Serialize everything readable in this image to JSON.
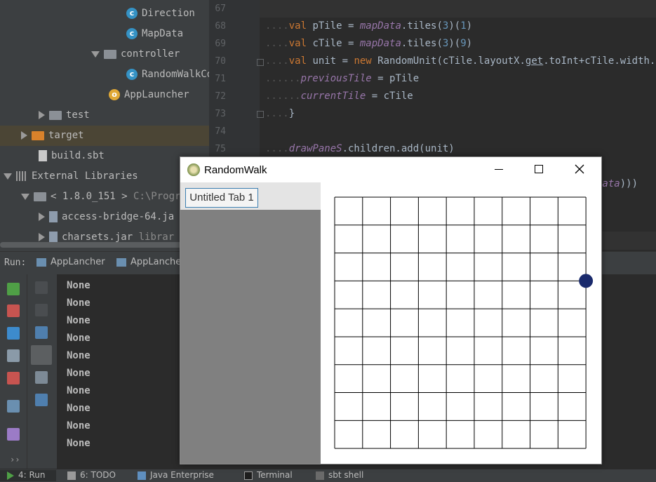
{
  "project_tree": {
    "items": [
      {
        "label": "Direction"
      },
      {
        "label": "MapData"
      },
      {
        "label": "controller"
      },
      {
        "label": "RandomWalkCo"
      },
      {
        "label": "AppLauncher"
      },
      {
        "label": "test"
      },
      {
        "label": "target"
      },
      {
        "label": "build.sbt"
      },
      {
        "label": "External Libraries"
      },
      {
        "label": "< 1.8.0_151 >",
        "extra": "C:\\Progr"
      },
      {
        "label": "access-bridge-64.ja"
      },
      {
        "label": "charsets.jar",
        "extra": "librar"
      }
    ]
  },
  "editor": {
    "line_numbers": [
      "67",
      "68",
      "69",
      "70",
      "71",
      "72",
      "73",
      "74",
      "75"
    ],
    "overflow_text": "Data)))"
  },
  "run": {
    "label": "Run:",
    "tabs": [
      "AppLancher",
      "AppLancher"
    ],
    "output": [
      "None",
      "None",
      "None",
      "None",
      "None",
      "None",
      "None",
      "None",
      "None",
      "None"
    ]
  },
  "bottom_tabs": [
    "4: Run",
    "6: TODO",
    "Java Enterprise",
    "Terminal",
    "sbt shell"
  ],
  "app_window": {
    "title": "RandomWalk",
    "tab_label": "Untitled Tab 1",
    "grid": {
      "rows": 9,
      "cols": 9
    },
    "unit_marker": {
      "row_line": 3,
      "col_line": 9,
      "color": "#1a2a6c"
    }
  },
  "colors": {
    "ide_bg": "#2b2b2b",
    "panel_bg": "#3c3f41",
    "keyword": "#cc7832",
    "field": "#9876aa",
    "number": "#6897bb"
  }
}
